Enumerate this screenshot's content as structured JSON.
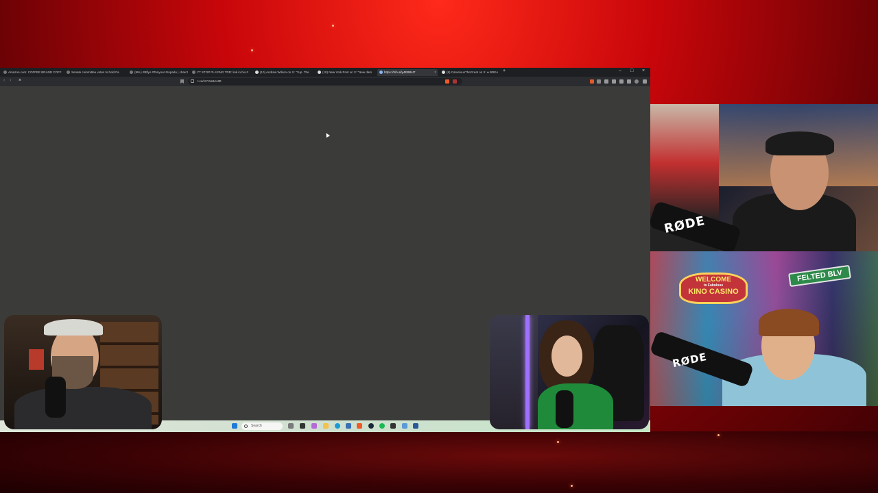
{
  "browser": {
    "tabs": [
      {
        "label": "Amazon.com: COFFEE BRAND COFF"
      },
      {
        "label": "Senate committee votes to hold Fa"
      },
      {
        "label": "(99+) #Bflyo #Tonyour #ropado | charct"
      },
      {
        "label": "YT STOP PLAYING TRD: link in bio #"
      },
      {
        "label": "(10) Andrew Wilson on X: \"Yup. The"
      },
      {
        "label": "(10) New York Post on X: \"New dam"
      },
      {
        "label": "https://trib.al/y4EBBHT",
        "active": true
      },
      {
        "label": "(8) CarvelousTheGreat on X: ● BREA"
      }
    ],
    "url": "t.co/xVYVe9AHt0",
    "window_controls": [
      "–",
      "□",
      "×"
    ]
  },
  "taskbar": {
    "search_label": "Search"
  },
  "overlays": {
    "rode_label": "RØDE",
    "kino_welcome": "WELCOME",
    "kino_sub": "to Fabulous",
    "kino_title": "KINO CASINO",
    "felted_sign": "FELTED BLV"
  }
}
